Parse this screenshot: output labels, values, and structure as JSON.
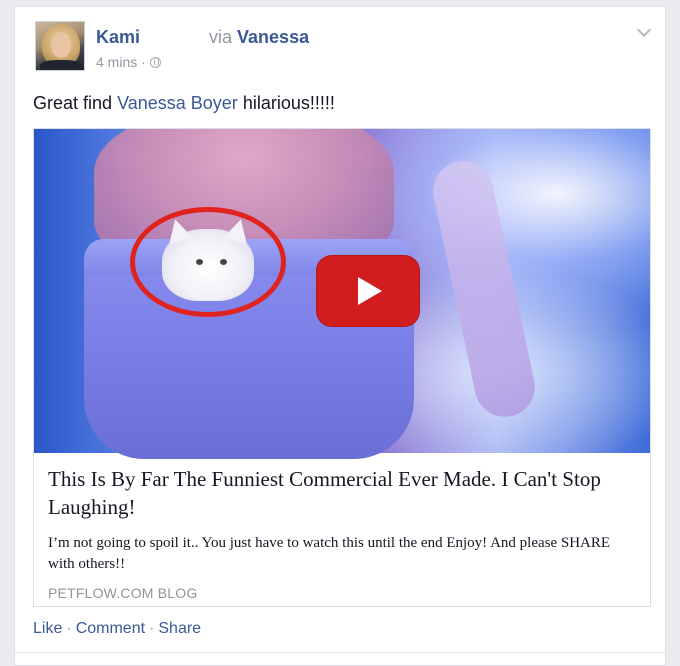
{
  "post": {
    "author": "Kami",
    "via_prefix": "via",
    "via_name": "Vanessa",
    "time": "4 mins ·",
    "message_before": "Great find",
    "message_mention": "Vanessa Boyer",
    "message_after": "hilarious!!!!!"
  },
  "attachment": {
    "title": "This Is By Far The Funniest Commercial Ever Made. I Can't Stop Laughing!",
    "description": "I’m not going to spoil it.. You just have to watch this until the end Enjoy! And please SHARE with others!!",
    "source": "PETFLOW.COM BLOG"
  },
  "actions": {
    "like": "Like",
    "comment": "Comment",
    "share": "Share",
    "separator": "·"
  },
  "icons": {
    "privacy": "globe-icon",
    "menu": "chevron-down-icon",
    "play": "play-button-icon"
  },
  "colors": {
    "link": "#3b5998",
    "muted": "#9197a3",
    "play": "#d11d1d",
    "highlight_circle": "#e0231d"
  }
}
